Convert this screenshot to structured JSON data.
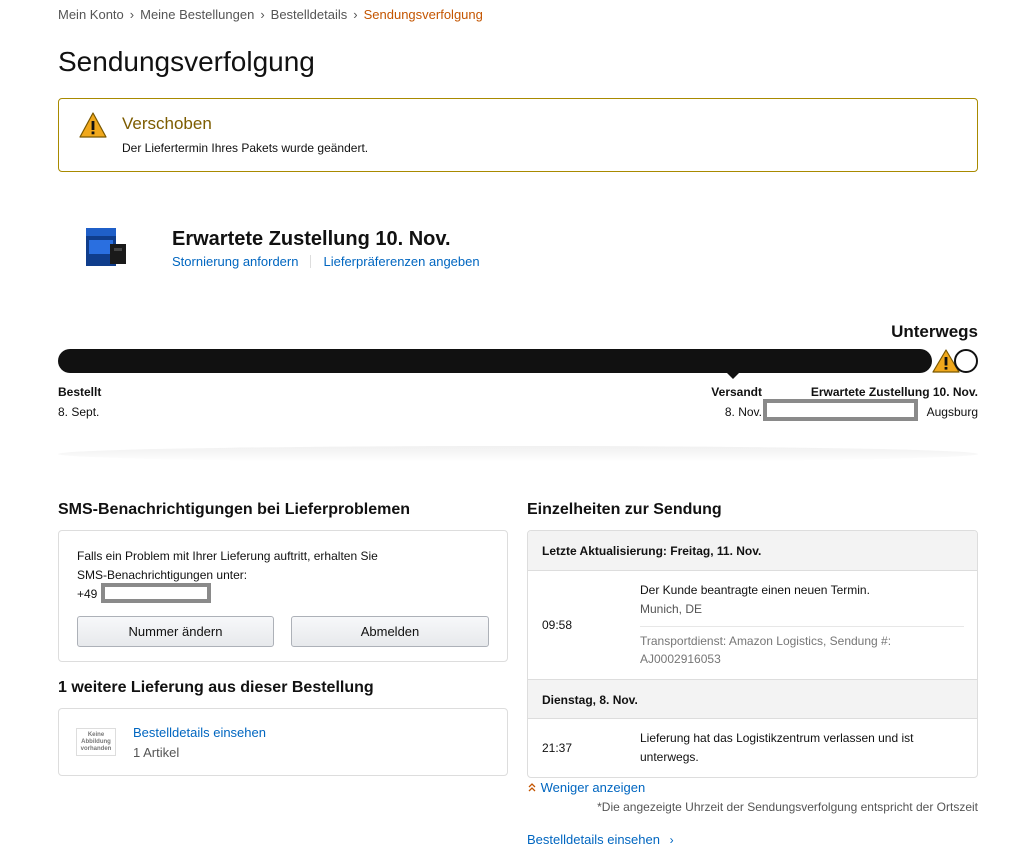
{
  "breadcrumb": {
    "items": [
      "Mein Konto",
      "Meine Bestellungen",
      "Bestelldetails",
      "Sendungsverfolgung"
    ],
    "separator": "›"
  },
  "page_title": "Sendungsverfolgung",
  "alert": {
    "title": "Verschoben",
    "text": "Der Liefertermin Ihres Pakets wurde geändert.",
    "icon": "warning-icon"
  },
  "delivery": {
    "heading": "Erwartete Zustellung 10. Nov.",
    "cancel_link": "Stornierung anfordern",
    "preferences_link": "Lieferpräferenzen angeben",
    "product_image": "ps4-console-image"
  },
  "progress": {
    "status": "Unterwegs",
    "value": 0.92,
    "milestones": {
      "ordered": {
        "label": "Bestellt",
        "date": "8. Sept."
      },
      "shipped": {
        "label": "Versandt",
        "date": "8. Nov."
      },
      "expected": {
        "label": "Erwartete Zustellung 10. Nov.",
        "location": "Augsburg"
      }
    }
  },
  "sms": {
    "title": "SMS-Benachrichtigungen bei Lieferproblemen",
    "text_line1": "Falls ein Problem mit Ihrer Lieferung auftritt, erhalten Sie",
    "text_line2": "SMS-Benachrichtigungen unter:",
    "phone_prefix": "+49",
    "change_button": "Nummer ändern",
    "unsubscribe_button": "Abmelden"
  },
  "more_deliveries": {
    "title": "1 weitere Lieferung aus dieser Bestellung",
    "no_image_text": "Keine Abbildung vorhanden",
    "link": "Bestelldetails einsehen",
    "count": "1 Artikel"
  },
  "details": {
    "title": "Einzelheiten zur Sendung",
    "groups": [
      {
        "date": "Letzte Aktualisierung: Freitag, 11. Nov.",
        "time": "09:58",
        "event": "Der Kunde beantragte einen neuen Termin.",
        "location": "Munich, DE",
        "carrier_line1": "Transportdienst: Amazon Logistics, Sendung #:",
        "carrier_line2": "AJ0002916053"
      },
      {
        "date": "Dienstag, 8. Nov.",
        "time": "21:37",
        "event": "Lieferung hat das Logistikzentrum verlassen und ist unterwegs."
      }
    ],
    "less_link": "Weniger anzeigen",
    "note": "*Die angezeigte Uhrzeit der Sendungsverfolgung entspricht der Ortszeit",
    "bottom_link": "Bestelldetails einsehen",
    "bottom_link_arrow": "›"
  },
  "colors": {
    "link": "#0066c0",
    "active_crumb": "#c45500",
    "alert_border": "#a88a00",
    "alert_title": "#7d5c00",
    "warning_fill": "#f0a81c"
  }
}
